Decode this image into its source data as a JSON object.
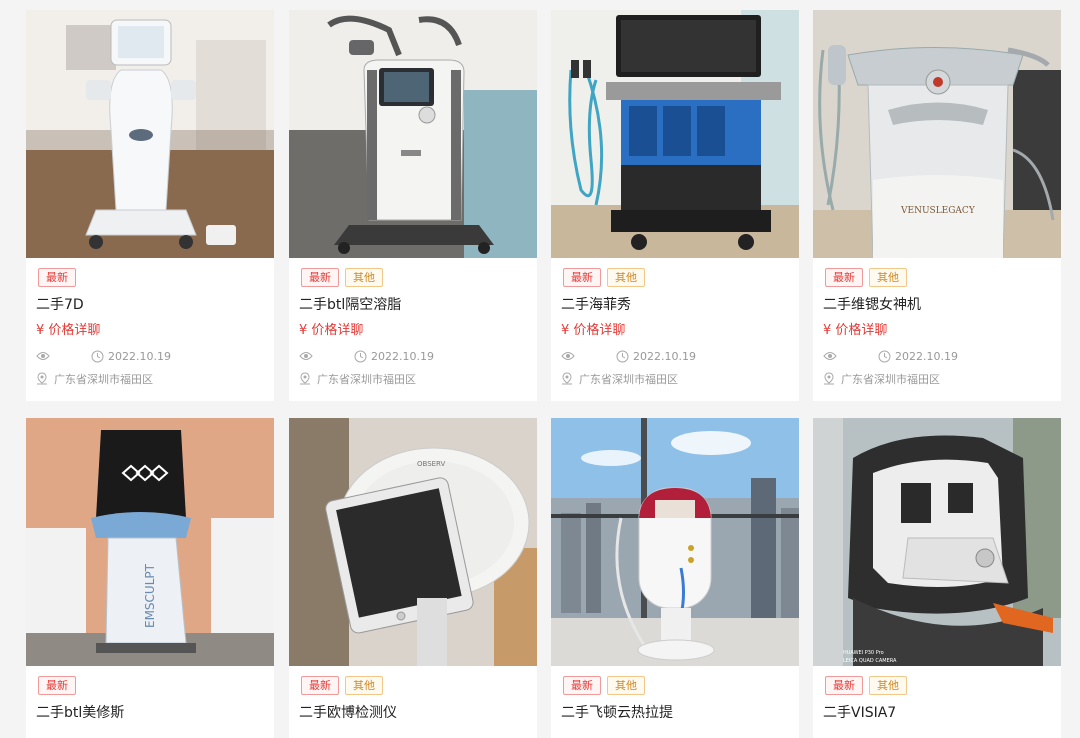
{
  "tags": {
    "new": "最新",
    "other": "其他"
  },
  "products": [
    {
      "title": "二手7D",
      "price": "¥ 价格详聊",
      "date": "2022.10.19",
      "location": "广东省深圳市福田区",
      "tags": [
        "new"
      ],
      "image": "hifu-7d-machine"
    },
    {
      "title": "二手btl隔空溶脂",
      "price": "¥ 价格详聊",
      "date": "2022.10.19",
      "location": "广东省深圳市福田区",
      "tags": [
        "new",
        "other"
      ],
      "image": "btl-fat-reduction-machine"
    },
    {
      "title": "二手海菲秀",
      "price": "¥ 价格详聊",
      "date": "2022.10.19",
      "location": "广东省深圳市福田区",
      "tags": [
        "new",
        "other"
      ],
      "image": "hydrafacial-machine"
    },
    {
      "title": "二手维锶女神机",
      "price": "¥ 价格详聊",
      "date": "2022.10.19",
      "location": "广东省深圳市福田区",
      "tags": [
        "new",
        "other"
      ],
      "image": "venus-legacy-machine"
    },
    {
      "title": "二手btl美修斯",
      "tags": [
        "new"
      ],
      "image": "emsculpt-machine"
    },
    {
      "title": "二手欧博检测仪",
      "tags": [
        "new",
        "other"
      ],
      "image": "observ-skin-analyzer"
    },
    {
      "title": "二手飞顿云热拉提",
      "tags": [
        "new",
        "other"
      ],
      "image": "rf-lifting-machine"
    },
    {
      "title": "二手VISIA7",
      "tags": [
        "new",
        "other"
      ],
      "image": "visia-skin-analyzer"
    }
  ],
  "image_text": {
    "venus_logo": "VENUSLEGACY",
    "emsculpt_logo": "EMSCULPT",
    "observ_logo": "OBSERV",
    "camera_watermark_1": "HUAWEI P30 Pro",
    "camera_watermark_2": "LEICA QUAD CAMERA"
  },
  "colors": {
    "price": "#e53935",
    "tag_new": "#e53935",
    "tag_other": "#d08a1e",
    "meta": "#999999"
  }
}
